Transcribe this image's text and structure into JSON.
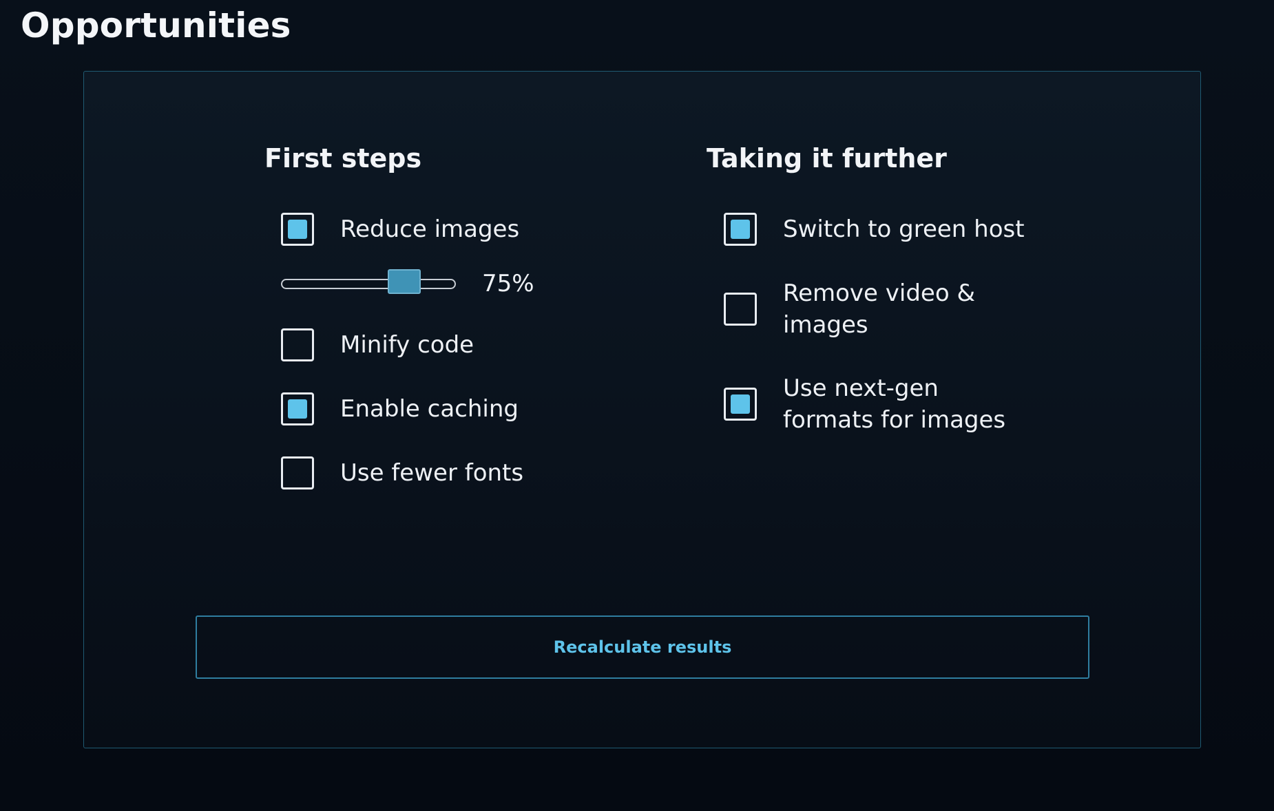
{
  "page": {
    "title": "Opportunities"
  },
  "columns": {
    "first_steps": {
      "heading": "First steps",
      "reduce_images": {
        "label": "Reduce images",
        "checked": true
      },
      "slider": {
        "value": 75,
        "value_label": "75%"
      },
      "minify_code": {
        "label": "Minify code",
        "checked": false
      },
      "enable_caching": {
        "label": "Enable caching",
        "checked": true
      },
      "fewer_fonts": {
        "label": "Use fewer fonts",
        "checked": false
      }
    },
    "taking_further": {
      "heading": "Taking it further",
      "green_host": {
        "label": "Switch to green host",
        "checked": true
      },
      "remove_media": {
        "label": "Remove video & images",
        "checked": false
      },
      "next_gen_formats": {
        "label": "Use next-gen formats for images",
        "checked": true
      }
    }
  },
  "actions": {
    "recalculate_label": "Recalculate results"
  },
  "colors": {
    "accent": "#5ec3ea",
    "border": "#1f5a72",
    "background": "#050a12"
  }
}
